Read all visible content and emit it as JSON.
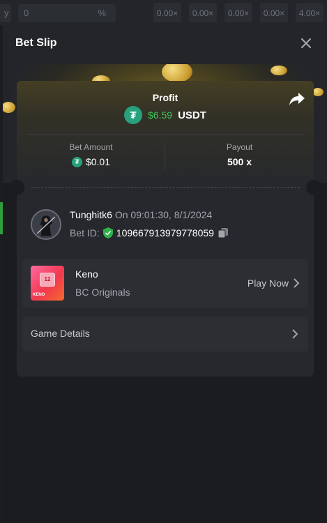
{
  "background": {
    "fields": [
      "y",
      "0",
      "%"
    ],
    "multipliers": [
      "0.00×",
      "0.00×",
      "0.00×",
      "0.00×",
      "4.00×"
    ]
  },
  "modal": {
    "title": "Bet Slip",
    "close_icon": "close-icon"
  },
  "profit": {
    "label": "Profit",
    "amount": "$6.59",
    "currency": "USDT",
    "share_icon": "share-icon"
  },
  "bet": {
    "amount_label": "Bet Amount",
    "amount_value": "$0.01",
    "payout_label": "Payout",
    "payout_value": "500 x"
  },
  "user": {
    "name": "Tunghitk6",
    "timestamp": "On 09:01:30, 8/1/2024",
    "bet_id_label": "Bet ID:",
    "bet_id": "109667913979778059"
  },
  "game": {
    "name": "Keno",
    "provider": "BC Originals",
    "play_label": "Play Now",
    "thumb_label": "KENO",
    "thumb_number": "12"
  },
  "details": {
    "label": "Game Details"
  },
  "colors": {
    "accent_green": "#3fc35a",
    "tether": "#26a17b",
    "panel": "#26282d",
    "header": "#232529"
  }
}
